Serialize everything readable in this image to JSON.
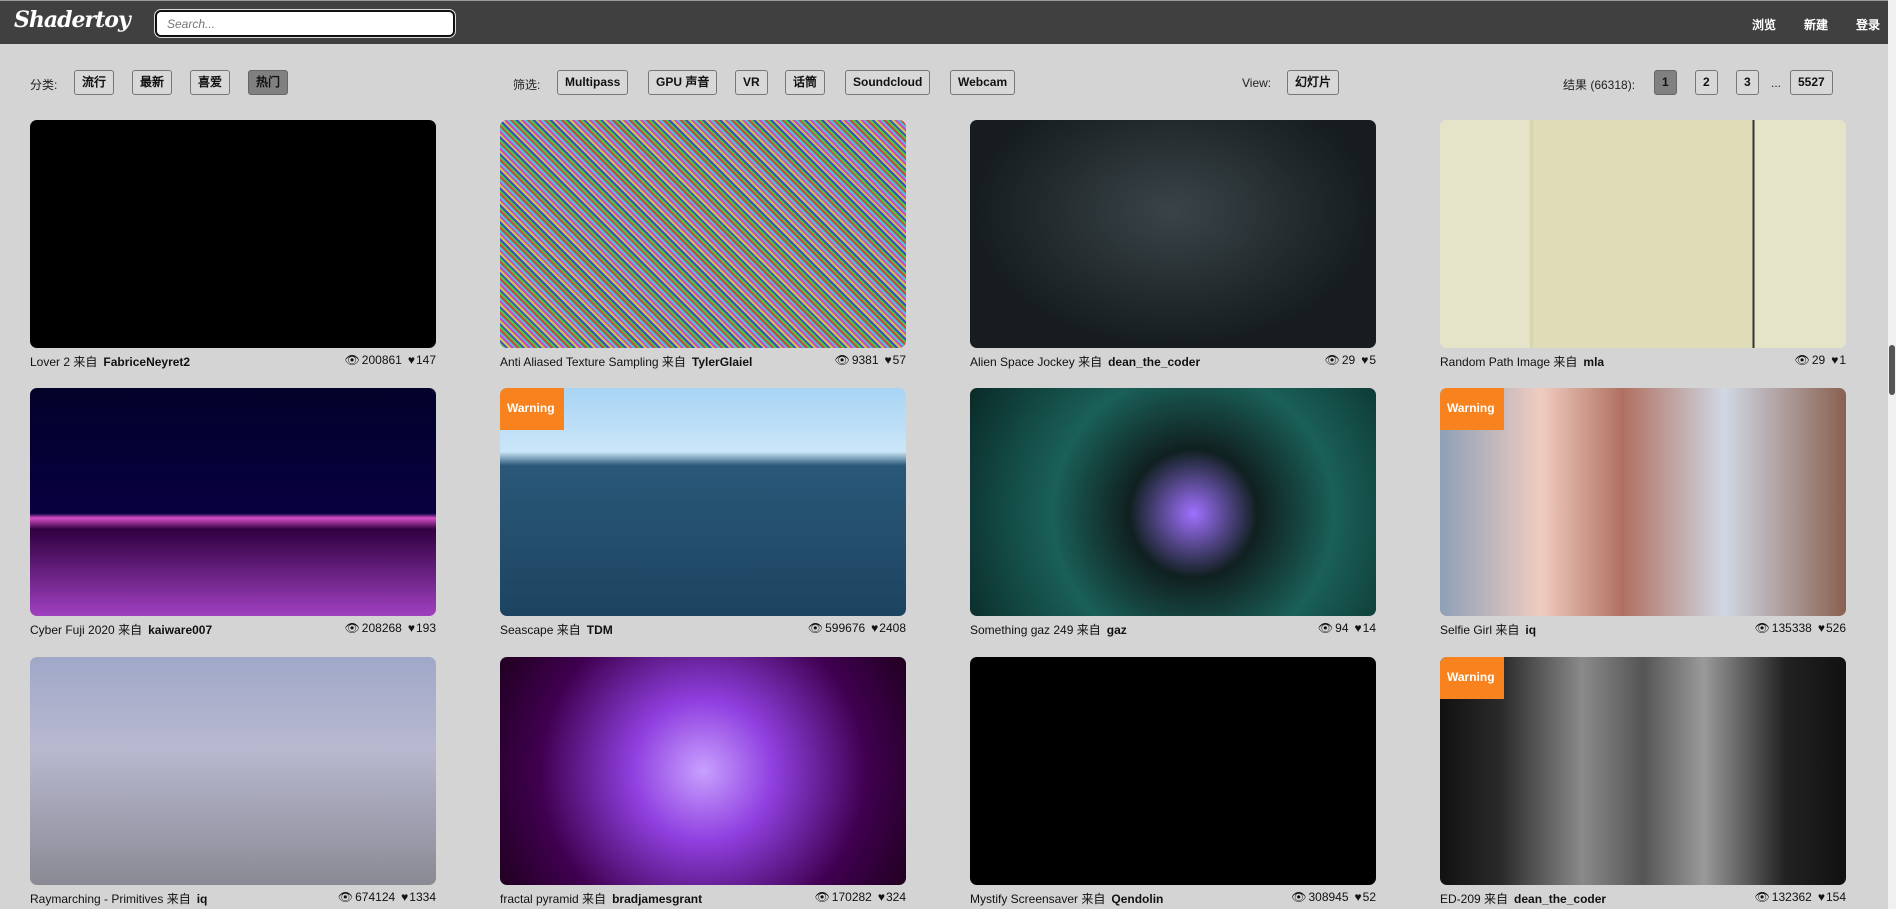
{
  "header": {
    "logo": "Shadertoy",
    "search_placeholder": "Search...",
    "nav": [
      "浏览",
      "新建",
      "登录"
    ]
  },
  "toolbar": {
    "category_label": "分类:",
    "categories": [
      "流行",
      "最新",
      "喜爱",
      "热门"
    ],
    "active_category": "热门",
    "filter_label": "筛选:",
    "filters": [
      "Multipass",
      "GPU 声音",
      "VR",
      "话筒",
      "Soundcloud",
      "Webcam"
    ],
    "view_label": "View:",
    "view_button": "幻灯片",
    "results_label": "结果 (66318):",
    "pages": [
      "1",
      "2",
      "3"
    ],
    "ellipsis": "...",
    "last_page": "5527",
    "current_page": "1"
  },
  "by_label": "来自",
  "warning_label": "Warning",
  "shaders": [
    {
      "title": "Lover 2",
      "author": "FabriceNeyret2",
      "views": "200861",
      "likes": "147",
      "warning": false
    },
    {
      "title": "Anti Aliased Texture Sampling",
      "author": "TylerGlaiel",
      "views": "9381",
      "likes": "57",
      "warning": false
    },
    {
      "title": "Alien Space Jockey",
      "author": "dean_the_coder",
      "views": "29",
      "likes": "5",
      "warning": false
    },
    {
      "title": "Random Path Image",
      "author": "mla",
      "views": "29",
      "likes": "1",
      "warning": false
    },
    {
      "title": "Cyber Fuji 2020",
      "author": "kaiware007",
      "views": "208268",
      "likes": "193",
      "warning": false
    },
    {
      "title": "Seascape",
      "author": "TDM",
      "views": "599676",
      "likes": "2408",
      "warning": true
    },
    {
      "title": "Something gaz 249",
      "author": "gaz",
      "views": "94",
      "likes": "14",
      "warning": false
    },
    {
      "title": "Selfie Girl",
      "author": "iq",
      "views": "135338",
      "likes": "526",
      "warning": true
    },
    {
      "title": "Raymarching - Primitives",
      "author": "iq",
      "views": "674124",
      "likes": "1334",
      "warning": false
    },
    {
      "title": "fractal pyramid",
      "author": "bradjamesgrant",
      "views": "170282",
      "likes": "324",
      "warning": false
    },
    {
      "title": "Mystify Screensaver",
      "author": "Qendolin",
      "views": "308945",
      "likes": "52",
      "warning": false
    },
    {
      "title": "ED-209",
      "author": "dean_the_coder",
      "views": "132362",
      "likes": "154",
      "warning": true
    }
  ],
  "colors": {
    "header": "#404040",
    "warning": "#f7821e",
    "active_button": "#808080"
  }
}
